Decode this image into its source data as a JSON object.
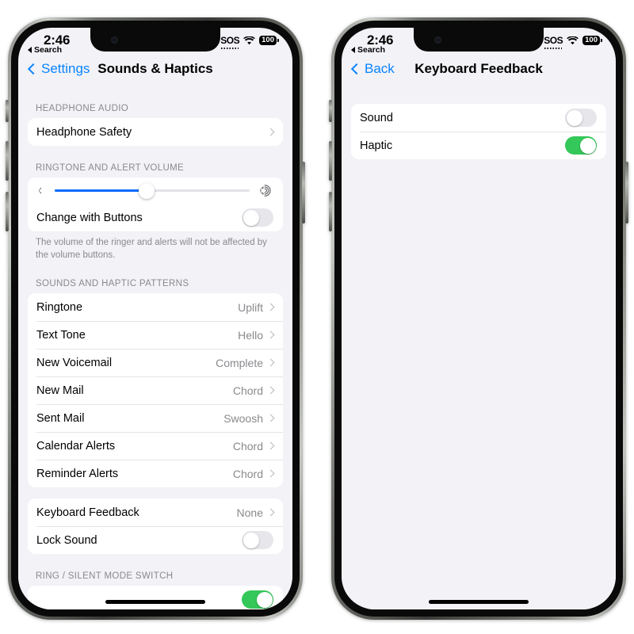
{
  "phones": [
    {
      "status": {
        "time": "2:46",
        "back_to_app": "Search",
        "sos": "SOS",
        "wifi_icon": "wifi-icon",
        "battery": "100"
      },
      "nav": {
        "back_label": "Settings",
        "title": "Sounds & Haptics"
      },
      "sections": [
        {
          "header": "HEADPHONE AUDIO",
          "rows": [
            {
              "label": "Headphone Safety",
              "type": "disclosure"
            }
          ]
        },
        {
          "header": "RINGTONE AND ALERT VOLUME",
          "footer": "The volume of the ringer and alerts will not be affected by the volume buttons.",
          "rows": [
            {
              "type": "slider",
              "value_percent": 47,
              "left_icon": "speaker-low-icon",
              "right_icon": "speaker-high-icon"
            },
            {
              "label": "Change with Buttons",
              "type": "toggle",
              "on": false
            }
          ]
        },
        {
          "header": "SOUNDS AND HAPTIC PATTERNS",
          "rows": [
            {
              "label": "Ringtone",
              "value": "Uplift",
              "type": "disclosure"
            },
            {
              "label": "Text Tone",
              "value": "Hello",
              "type": "disclosure"
            },
            {
              "label": "New Voicemail",
              "value": "Complete",
              "type": "disclosure"
            },
            {
              "label": "New Mail",
              "value": "Chord",
              "type": "disclosure"
            },
            {
              "label": "Sent Mail",
              "value": "Swoosh",
              "type": "disclosure"
            },
            {
              "label": "Calendar Alerts",
              "value": "Chord",
              "type": "disclosure"
            },
            {
              "label": "Reminder Alerts",
              "value": "Chord",
              "type": "disclosure"
            }
          ]
        },
        {
          "header": "",
          "rows": [
            {
              "label": "Keyboard Feedback",
              "value": "None",
              "type": "disclosure"
            },
            {
              "label": "Lock Sound",
              "type": "toggle",
              "on": false
            }
          ]
        },
        {
          "header": "RING / SILENT MODE SWITCH",
          "clipped": true,
          "rows": [
            {
              "label": "",
              "type": "toggle",
              "on": true
            }
          ]
        }
      ]
    },
    {
      "status": {
        "time": "2:46",
        "back_to_app": "Search",
        "sos": "SOS",
        "wifi_icon": "wifi-icon",
        "battery": "100"
      },
      "nav": {
        "back_label": "Back",
        "title": "Keyboard Feedback"
      },
      "sections": [
        {
          "header": "",
          "rows": [
            {
              "label": "Sound",
              "type": "toggle",
              "on": false
            },
            {
              "label": "Haptic",
              "type": "toggle",
              "on": true
            }
          ]
        }
      ]
    }
  ],
  "colors": {
    "accent_blue": "#0a84ff",
    "slider_blue": "#0a6cff",
    "toggle_on_green": "#34c759",
    "toggle_off_gray": "#e6e6eb",
    "screen_bg": "#f2f2f7",
    "secondary_text": "#8a8a8e"
  }
}
